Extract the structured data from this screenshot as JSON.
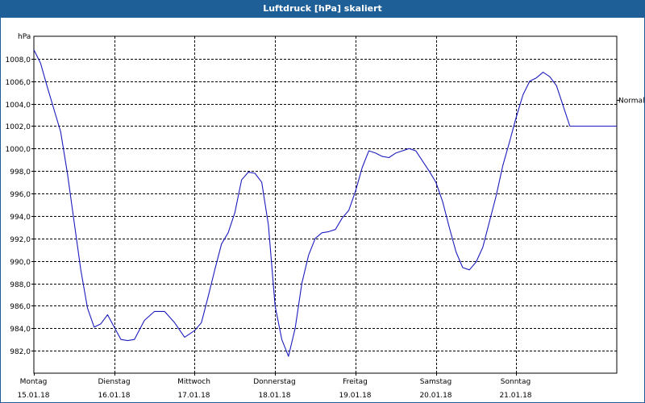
{
  "window": {
    "title": "Luftdruck [hPa] skaliert"
  },
  "colors": {
    "titlebar": "#1f5f97",
    "series": "#1c1cbe",
    "grid": "#000000",
    "background": "#ffffff"
  },
  "chart_data": {
    "type": "line",
    "title": "Luftdruck [hPa] skaliert",
    "ylabel": "hPa",
    "ylim": [
      980.0,
      1010.0
    ],
    "yticks": [
      982.0,
      984.0,
      986.0,
      988.0,
      990.0,
      992.0,
      994.0,
      996.0,
      998.0,
      1000.0,
      1002.0,
      1004.0,
      1006.0,
      1008.0
    ],
    "ytick_labels": [
      "982,0",
      "984,0",
      "986,0",
      "988,0",
      "990,0",
      "992,0",
      "994,0",
      "996,0",
      "998,0",
      "1000,0",
      "1002,0",
      "1004,0",
      "1006,0",
      "1008,0"
    ],
    "xlim": [
      "2018-01-15T00:00",
      "2018-01-22T06:00"
    ],
    "xticks": [
      {
        "x": "2018-01-15T00:00",
        "day": "Montag",
        "date": "15.01.18"
      },
      {
        "x": "2018-01-16T00:00",
        "day": "Dienstag",
        "date": "16.01.18"
      },
      {
        "x": "2018-01-17T00:00",
        "day": "Mittwoch",
        "date": "17.01.18"
      },
      {
        "x": "2018-01-18T00:00",
        "day": "Donnerstag",
        "date": "18.01.18"
      },
      {
        "x": "2018-01-19T00:00",
        "day": "Freitag",
        "date": "19.01.18"
      },
      {
        "x": "2018-01-20T00:00",
        "day": "Samstag",
        "date": "20.01.18"
      },
      {
        "x": "2018-01-21T00:00",
        "day": "Sonntag",
        "date": "21.01.18"
      }
    ],
    "reference_lines": [
      {
        "label": "Normal",
        "y": 1004.3
      }
    ],
    "grid": true,
    "series": [
      {
        "x": [
          "2018-01-15T00:00",
          "2018-01-15T02:00",
          "2018-01-15T04:00",
          "2018-01-15T06:00",
          "2018-01-15T08:00",
          "2018-01-15T10:00",
          "2018-01-15T12:00",
          "2018-01-15T14:00",
          "2018-01-15T16:00",
          "2018-01-15T18:00",
          "2018-01-15T20:00",
          "2018-01-15T22:00",
          "2018-01-16T00:00",
          "2018-01-16T02:00",
          "2018-01-16T04:00",
          "2018-01-16T06:00",
          "2018-01-16T09:00",
          "2018-01-16T12:00",
          "2018-01-16T15:00",
          "2018-01-16T18:00",
          "2018-01-16T21:00",
          "2018-01-17T00:00",
          "2018-01-17T02:00",
          "2018-01-17T04:00",
          "2018-01-17T06:00",
          "2018-01-17T08:00",
          "2018-01-17T10:00",
          "2018-01-17T12:00",
          "2018-01-17T14:00",
          "2018-01-17T16:00",
          "2018-01-17T18:00",
          "2018-01-17T20:00",
          "2018-01-17T22:00",
          "2018-01-18T00:00",
          "2018-01-18T02:00",
          "2018-01-18T04:00",
          "2018-01-18T06:00",
          "2018-01-18T08:00",
          "2018-01-18T10:00",
          "2018-01-18T12:00",
          "2018-01-18T14:00",
          "2018-01-18T16:00",
          "2018-01-18T18:00",
          "2018-01-18T20:00",
          "2018-01-18T22:00",
          "2018-01-19T00:00",
          "2018-01-19T02:00",
          "2018-01-19T04:00",
          "2018-01-19T06:00",
          "2018-01-19T08:00",
          "2018-01-19T10:00",
          "2018-01-19T12:00",
          "2018-01-19T14:00",
          "2018-01-19T16:00",
          "2018-01-19T18:00",
          "2018-01-19T20:00",
          "2018-01-19T22:00",
          "2018-01-20T00:00",
          "2018-01-20T02:00",
          "2018-01-20T04:00",
          "2018-01-20T06:00",
          "2018-01-20T08:00",
          "2018-01-20T10:00",
          "2018-01-20T12:00",
          "2018-01-20T14:00",
          "2018-01-20T16:00",
          "2018-01-20T18:00",
          "2018-01-20T20:00",
          "2018-01-20T22:00",
          "2018-01-21T00:00",
          "2018-01-21T02:00",
          "2018-01-21T04:00",
          "2018-01-21T06:00",
          "2018-01-21T08:00",
          "2018-01-21T10:00",
          "2018-01-21T12:00",
          "2018-01-21T14:00",
          "2018-01-21T16:00",
          "2018-01-21T18:00",
          "2018-01-21T20:00",
          "2018-01-21T22:00",
          "2018-01-22T00:00",
          "2018-01-22T02:00",
          "2018-01-22T04:00",
          "2018-01-22T06:00"
        ],
        "values": [
          1008.8,
          1007.6,
          1005.5,
          1003.5,
          1001.5,
          997.8,
          993.5,
          989.2,
          985.8,
          984.1,
          984.4,
          985.2,
          984.1,
          983.0,
          982.9,
          983.0,
          984.7,
          985.5,
          985.5,
          984.5,
          983.2,
          983.8,
          984.5,
          986.8,
          989.2,
          991.5,
          992.5,
          994.3,
          997.2,
          997.9,
          997.8,
          997.0,
          993.2,
          986.0,
          983.0,
          981.5,
          984.0,
          988.0,
          990.5,
          992.0,
          992.5,
          992.6,
          992.8,
          993.8,
          994.5,
          996.2,
          998.3,
          999.8,
          999.6,
          999.3,
          999.2,
          999.6,
          999.8,
          1000.0,
          999.8,
          998.9,
          998.0,
          997.0,
          995.3,
          993.0,
          990.8,
          989.4,
          989.2,
          989.9,
          991.2,
          993.5,
          995.8,
          998.5,
          1000.6,
          1002.8,
          1004.8,
          1006.0,
          1006.3,
          1006.8,
          1006.4,
          1005.6,
          1003.8,
          1002.0,
          1002.0,
          1002.0,
          1002.0,
          1002.0,
          1002.0,
          1002.0,
          1002.0
        ]
      }
    ]
  }
}
